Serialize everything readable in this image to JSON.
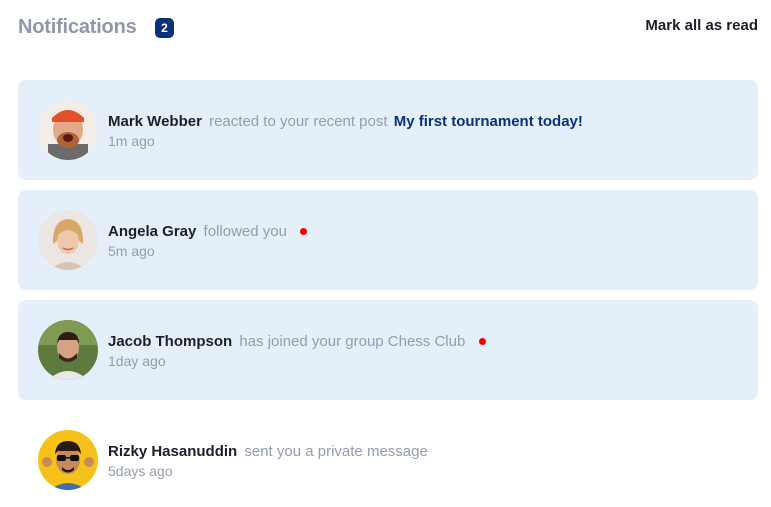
{
  "header": {
    "title": "Notifications",
    "unread_count": "2",
    "mark_all_label": "Mark all as read"
  },
  "notifications": [
    {
      "name": "Mark Webber",
      "action": "reacted to your recent post",
      "target": "My first tournament today!",
      "time": "1m ago",
      "unread_dot": false,
      "avatar": "avatar-mark-webber"
    },
    {
      "name": "Angela Gray",
      "action": "followed you",
      "target": "",
      "time": "5m ago",
      "unread_dot": true,
      "avatar": "avatar-angela-gray"
    },
    {
      "name": "Jacob Thompson",
      "action": "has joined your group Chess Club",
      "target": "",
      "time": "1day ago",
      "unread_dot": true,
      "avatar": "avatar-jacob-thompson"
    },
    {
      "name": "Rizky Hasanuddin",
      "action": "sent you a private message",
      "target": "",
      "time": "5days ago",
      "unread_dot": false,
      "avatar": "avatar-rizky-hasanuddin"
    }
  ],
  "colors": {
    "unread_bg": "#e5effa",
    "accent": "#0a327b",
    "dot": "#f40000",
    "muted": "#939cad"
  }
}
